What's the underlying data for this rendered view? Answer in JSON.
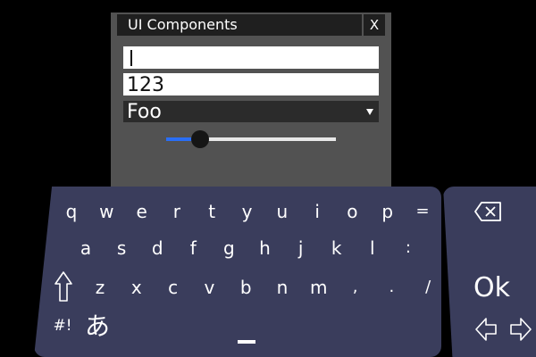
{
  "panel": {
    "title": "UI Components",
    "close_label": "X",
    "text_field_1": {
      "value": ""
    },
    "text_field_2": {
      "value": "123"
    },
    "dropdown": {
      "selected": "Foo"
    },
    "slider": {
      "value_fraction": 0.2
    }
  },
  "keyboard": {
    "rows": [
      [
        "q",
        "w",
        "e",
        "r",
        "t",
        "y",
        "u",
        "i",
        "o",
        "p",
        "="
      ],
      [
        "a",
        "s",
        "d",
        "f",
        "g",
        "h",
        "j",
        "k",
        "l",
        ":"
      ],
      [
        "z",
        "x",
        "c",
        "v",
        "b",
        "n",
        "m",
        ",",
        ".",
        "/"
      ]
    ],
    "symbols_label": "#!",
    "kana_label": "あ",
    "ok_label": "Ok"
  },
  "colors": {
    "background": "#000000",
    "panel": "#525252",
    "keyboard": "#3a3d5c",
    "slider_fill": "#2a6ef5"
  }
}
